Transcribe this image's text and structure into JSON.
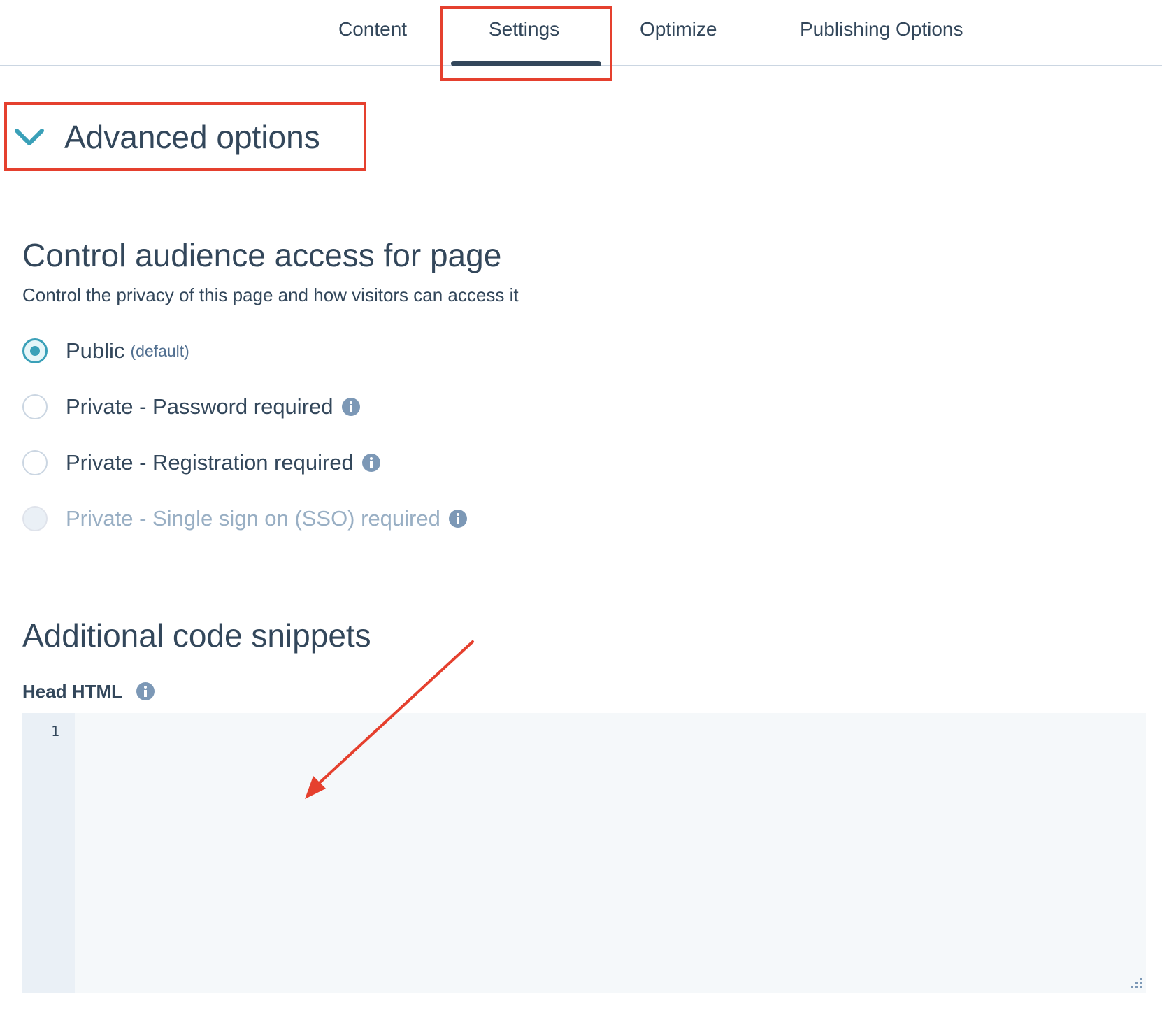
{
  "tabs": [
    {
      "label": "Content"
    },
    {
      "label": "Settings",
      "active": true
    },
    {
      "label": "Optimize"
    },
    {
      "label": "Publishing Options"
    }
  ],
  "advanced": {
    "title": "Advanced options",
    "expanded": true,
    "chevron_icon": "chevron-down-icon"
  },
  "audience": {
    "title": "Control audience access for page",
    "description": "Control the privacy of this page and how visitors can access it",
    "options": [
      {
        "label": "Public",
        "suffix": "(default)",
        "checked": true
      },
      {
        "label": "Private - Password required",
        "info": true
      },
      {
        "label": "Private - Registration required",
        "info": true
      },
      {
        "label": "Private - Single sign on (SSO) required",
        "info": true,
        "disabled": true
      }
    ]
  },
  "snippets": {
    "title": "Additional code snippets",
    "head_html_label": "Head HTML",
    "line_number": "1"
  },
  "colors": {
    "accent": "#3aa0b8",
    "annotation": "#e5402e",
    "text": "#33475b"
  }
}
